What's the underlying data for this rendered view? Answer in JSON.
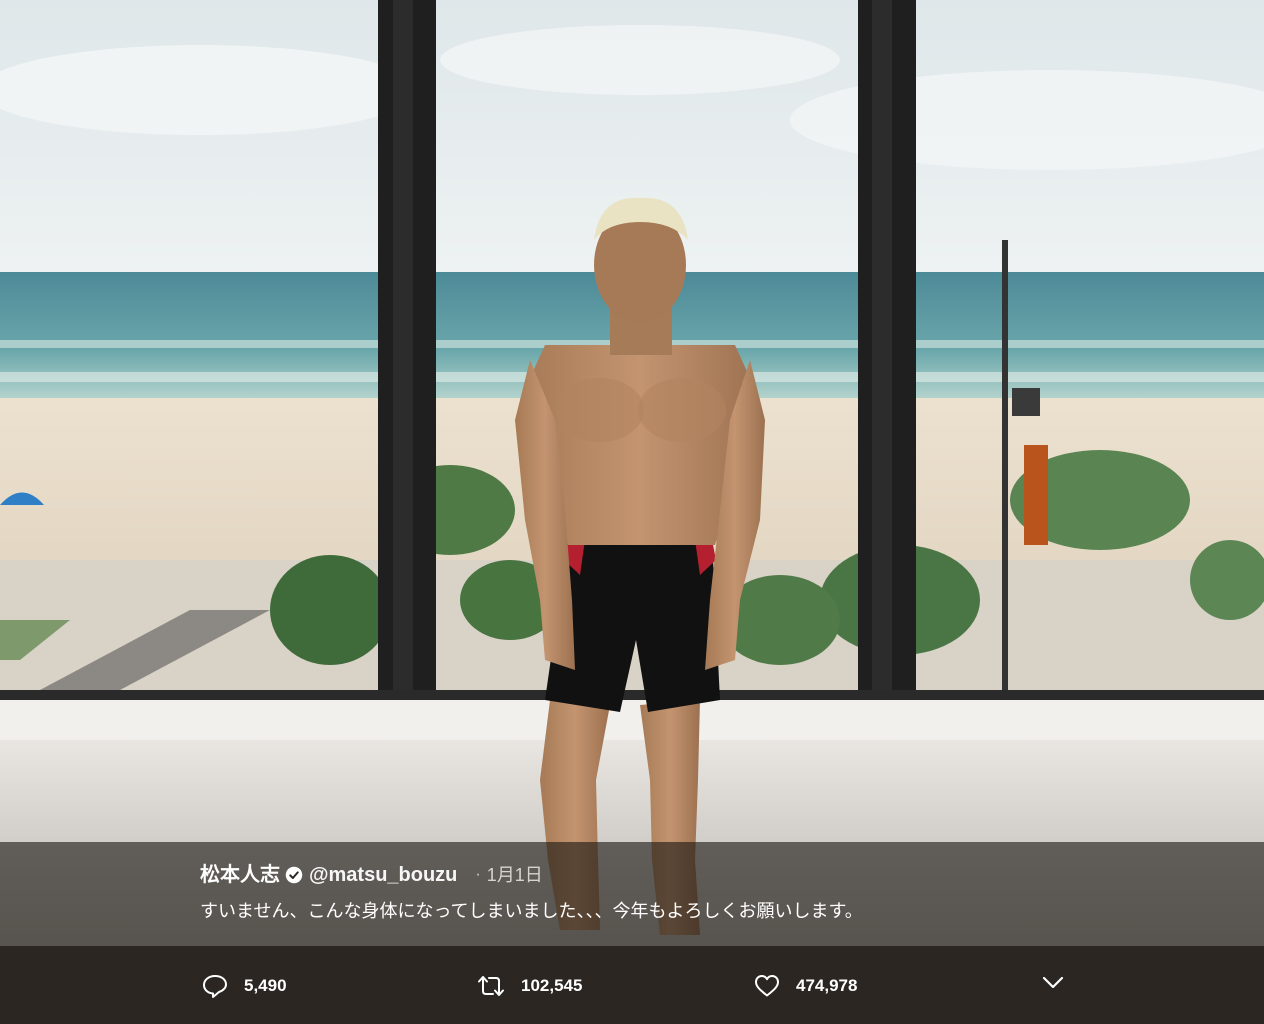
{
  "tweet": {
    "display_name": "松本人志",
    "verified_icon": "verified-badge-icon",
    "handle": "@matsu_bouzu",
    "separator": "·",
    "timestamp": "1月1日",
    "text": "すいません、こんな身体になってしまいました、、、今年もよろしくお願いします。"
  },
  "actions": {
    "reply": {
      "icon": "reply-icon",
      "count": "5,490"
    },
    "retweet": {
      "icon": "retweet-icon",
      "count": "102,545"
    },
    "like": {
      "icon": "heart-icon",
      "count": "474,978"
    },
    "more": {
      "icon": "chevron-down-icon"
    }
  },
  "colors": {
    "overlay": "#1c1814",
    "action_bar": "#2b2622",
    "text": "#ffffff",
    "muted": "#d8d3cd"
  }
}
